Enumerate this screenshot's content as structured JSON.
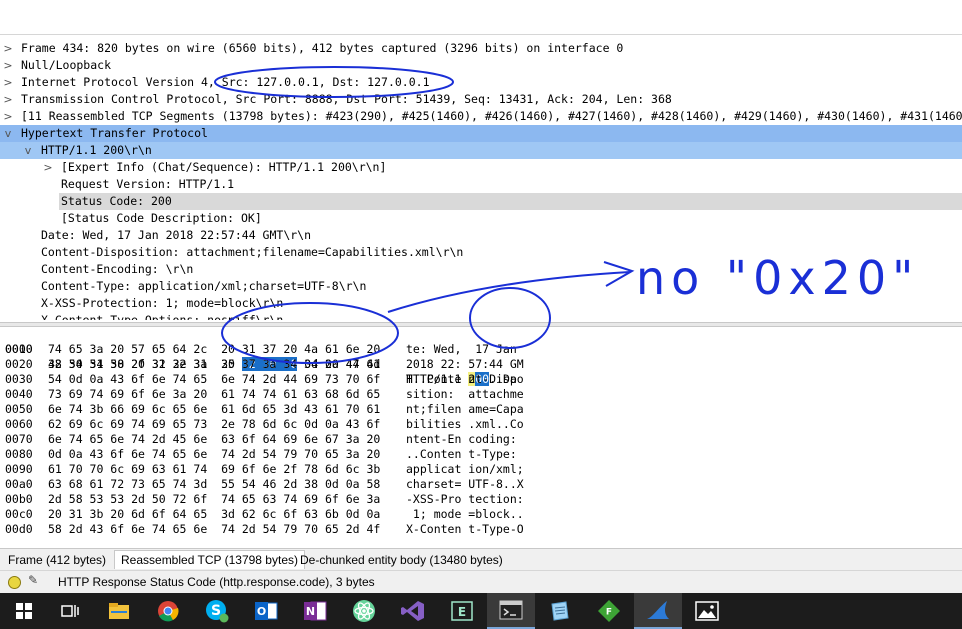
{
  "packet_tree": {
    "rows": [
      {
        "text": "Frame 434: 820 bytes on wire (6560 bits), 412 bytes captured (3296 bits) on interface 0",
        "chev": ">"
      },
      {
        "text": "Null/Loopback",
        "chev": ">"
      },
      {
        "text": "Internet Protocol Version 4, Src: 127.0.0.1, Dst: 127.0.0.1",
        "chev": ">"
      },
      {
        "text": "Transmission Control Protocol, Src Port: 8888, Dst Port: 51439, Seq: 13431, Ack: 204, Len: 368",
        "chev": ">"
      },
      {
        "text": "[11 Reassembled TCP Segments (13798 bytes): #423(290), #425(1460), #426(1460), #427(1460), #428(1460), #429(1460), #430(1460), #431(1460)",
        "chev": ">"
      },
      {
        "text": "Hypertext Transfer Protocol",
        "chev": "v"
      },
      {
        "text": "HTTP/1.1 200\\r\\n",
        "chev": "v"
      },
      {
        "text": "[Expert Info (Chat/Sequence): HTTP/1.1 200\\r\\n]",
        "chev": ">"
      },
      {
        "text": "Request Version: HTTP/1.1",
        "chev": ""
      },
      {
        "text": "Status Code: 200",
        "chev": ""
      },
      {
        "text": "[Status Code Description: OK]",
        "chev": ""
      },
      {
        "text": "Date: Wed, 17 Jan 2018 22:57:44 GMT\\r\\n",
        "chev": ""
      },
      {
        "text": "Content-Disposition: attachment;filename=Capabilities.xml\\r\\n",
        "chev": ""
      },
      {
        "text": "Content-Encoding: \\r\\n",
        "chev": ""
      },
      {
        "text": "Content-Type: application/xml;charset=UTF-8\\r\\n",
        "chev": ""
      },
      {
        "text": "X-XSS-Protection: 1; mode=block\\r\\n",
        "chev": ""
      },
      {
        "text": "X-Content-Type-Options: nosniff\\r\\n",
        "chev": ""
      }
    ]
  },
  "hex_dump": {
    "rows": [
      {
        "offset": "0000",
        "hex_a": "48 54 54 50 2f 31 2e 31  20 ",
        "hex_hl": "32 30 30",
        "hex_b": " 0d 0a 44 61",
        "ascii_a": "HTTP/1.1 ",
        "ascii_hl1": "2",
        "ascii_hl2": "00",
        "ascii_b": "..Da"
      },
      {
        "offset": "0010",
        "hex": "74 65 3a 20 57 65 64 2c  20 31 37 20 4a 61 6e 20",
        "ascii": "te: Wed,  17 Jan "
      },
      {
        "offset": "0020",
        "hex": "32 30 31 38 20 32 32 3a  35 37 3a 34 34 20 47 4d",
        "ascii": "2018 22: 57:44 GM"
      },
      {
        "offset": "0030",
        "hex": "54 0d 0a 43 6f 6e 74 65  6e 74 2d 44 69 73 70 6f",
        "ascii": "T..Conte nt-Dispo"
      },
      {
        "offset": "0040",
        "hex": "73 69 74 69 6f 6e 3a 20  61 74 74 61 63 68 6d 65",
        "ascii": "sition:  attachme"
      },
      {
        "offset": "0050",
        "hex": "6e 74 3b 66 69 6c 65 6e  61 6d 65 3d 43 61 70 61",
        "ascii": "nt;filen ame=Capa"
      },
      {
        "offset": "0060",
        "hex": "62 69 6c 69 74 69 65 73  2e 78 6d 6c 0d 0a 43 6f",
        "ascii": "bilities .xml..Co"
      },
      {
        "offset": "0070",
        "hex": "6e 74 65 6e 74 2d 45 6e  63 6f 64 69 6e 67 3a 20",
        "ascii": "ntent-En coding: "
      },
      {
        "offset": "0080",
        "hex": "0d 0a 43 6f 6e 74 65 6e  74 2d 54 79 70 65 3a 20",
        "ascii": "..Conten t-Type: "
      },
      {
        "offset": "0090",
        "hex": "61 70 70 6c 69 63 61 74  69 6f 6e 2f 78 6d 6c 3b",
        "ascii": "applicat ion/xml;"
      },
      {
        "offset": "00a0",
        "hex": "63 68 61 72 73 65 74 3d  55 54 46 2d 38 0d 0a 58",
        "ascii": "charset= UTF-8..X"
      },
      {
        "offset": "00b0",
        "hex": "2d 58 53 53 2d 50 72 6f  74 65 63 74 69 6f 6e 3a",
        "ascii": "-XSS-Pro tection:"
      },
      {
        "offset": "00c0",
        "hex": "20 31 3b 20 6d 6f 64 65  3d 62 6c 6f 63 6b 0d 0a",
        "ascii": " 1; mode =block.."
      },
      {
        "offset": "00d0",
        "hex": "58 2d 43 6f 6e 74 65 6e  74 2d 54 79 70 65 2d 4f",
        "ascii": "X-Conten t-Type-O"
      }
    ]
  },
  "bottom_tabs": [
    "Frame (412 bytes)",
    "Reassembled TCP (13798 bytes)",
    "De-chunked entity body (13480 bytes)"
  ],
  "status": {
    "message": "HTTP Response Status Code (http.response.code), 3 bytes"
  },
  "annotation": {
    "text": "no \"0x20\"",
    "color": "#1a2fd6"
  },
  "taskbar": {
    "items": [
      "windows-start-icon",
      "task-view-icon",
      "file-explorer-icon",
      "chrome-icon",
      "skype-icon",
      "outlook-icon",
      "onenote-icon",
      "atom-icon",
      "visual-studio-icon",
      "editor-icon",
      "terminal-icon",
      "notepad-icon",
      "green-app-icon",
      "wireshark-icon",
      "photos-icon"
    ]
  }
}
